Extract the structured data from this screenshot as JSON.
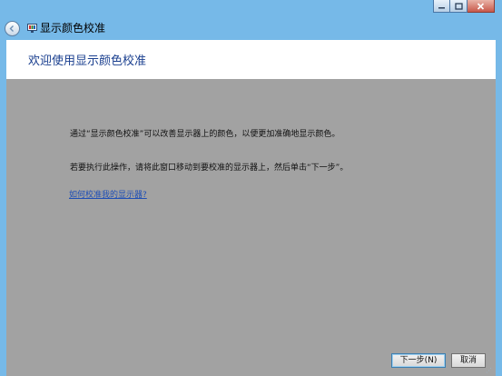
{
  "window": {
    "title": "显示颜色校准",
    "icon": "display-color-calibration-icon"
  },
  "titlebar": {
    "back_icon": "back-arrow-icon",
    "minimize_icon": "minimize-icon",
    "maximize_icon": "maximize-icon",
    "close_icon": "close-icon"
  },
  "page": {
    "heading": "欢迎使用显示颜色校准",
    "description_1": "通过“显示颜色校准”可以改善显示器上的颜色，以便更加准确地显示颜色。",
    "description_2": "若要执行此操作，请将此窗口移动到要校准的显示器上，然后单击“下一步”。",
    "help_link": "如何校准我的显示器?"
  },
  "buttons": {
    "next": "下一步(N)",
    "cancel": "取消"
  },
  "colors": {
    "frame": "#76b9e8",
    "content_background": "#a2a2a2",
    "heading": "#1a3f8f",
    "link": "#1f4fb6"
  }
}
